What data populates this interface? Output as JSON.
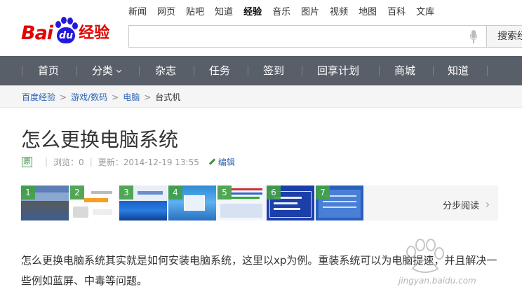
{
  "header": {
    "logo": {
      "bai": "Bai",
      "du": "du",
      "jingyan": "经验"
    },
    "topnav": [
      {
        "label": "新闻",
        "active": false
      },
      {
        "label": "网页",
        "active": false
      },
      {
        "label": "贴吧",
        "active": false
      },
      {
        "label": "知道",
        "active": false
      },
      {
        "label": "经验",
        "active": true
      },
      {
        "label": "音乐",
        "active": false
      },
      {
        "label": "图片",
        "active": false
      },
      {
        "label": "视频",
        "active": false
      },
      {
        "label": "地图",
        "active": false
      },
      {
        "label": "百科",
        "active": false
      },
      {
        "label": "文库",
        "active": false
      }
    ],
    "search": {
      "value": "",
      "button_label": "搜索经"
    }
  },
  "mainnav": [
    {
      "label": "首页"
    },
    {
      "label": "分类"
    },
    {
      "label": "杂志"
    },
    {
      "label": "任务"
    },
    {
      "label": "签到"
    },
    {
      "label": "回享计划"
    },
    {
      "label": "商城"
    },
    {
      "label": "知道"
    }
  ],
  "breadcrumb": [
    "百度经验",
    "游戏/数码",
    "电脑",
    "台式机"
  ],
  "article": {
    "title": "怎么更换电脑系统",
    "badge": "原",
    "views": "浏览：0",
    "updated": "更新：2014-12-19 13:55",
    "edit_label": "编辑",
    "steps": [
      "1",
      "2",
      "3",
      "4",
      "5",
      "6",
      "7"
    ],
    "step_read_label": "分步阅读",
    "body": "怎么更换电脑系统其实就是如何安装电脑系统，这里以xp为例。重装系统可以为电脑提速，并且解决一些例如蓝屏、中毒等问题。"
  },
  "watermark": {
    "text": "jingyan.baidu.com"
  },
  "colors": {
    "brand_red": "#e10602",
    "brand_blue": "#2319dc",
    "nav_bg": "#595f69",
    "link": "#2d64b3",
    "step_green": "#43a047"
  }
}
